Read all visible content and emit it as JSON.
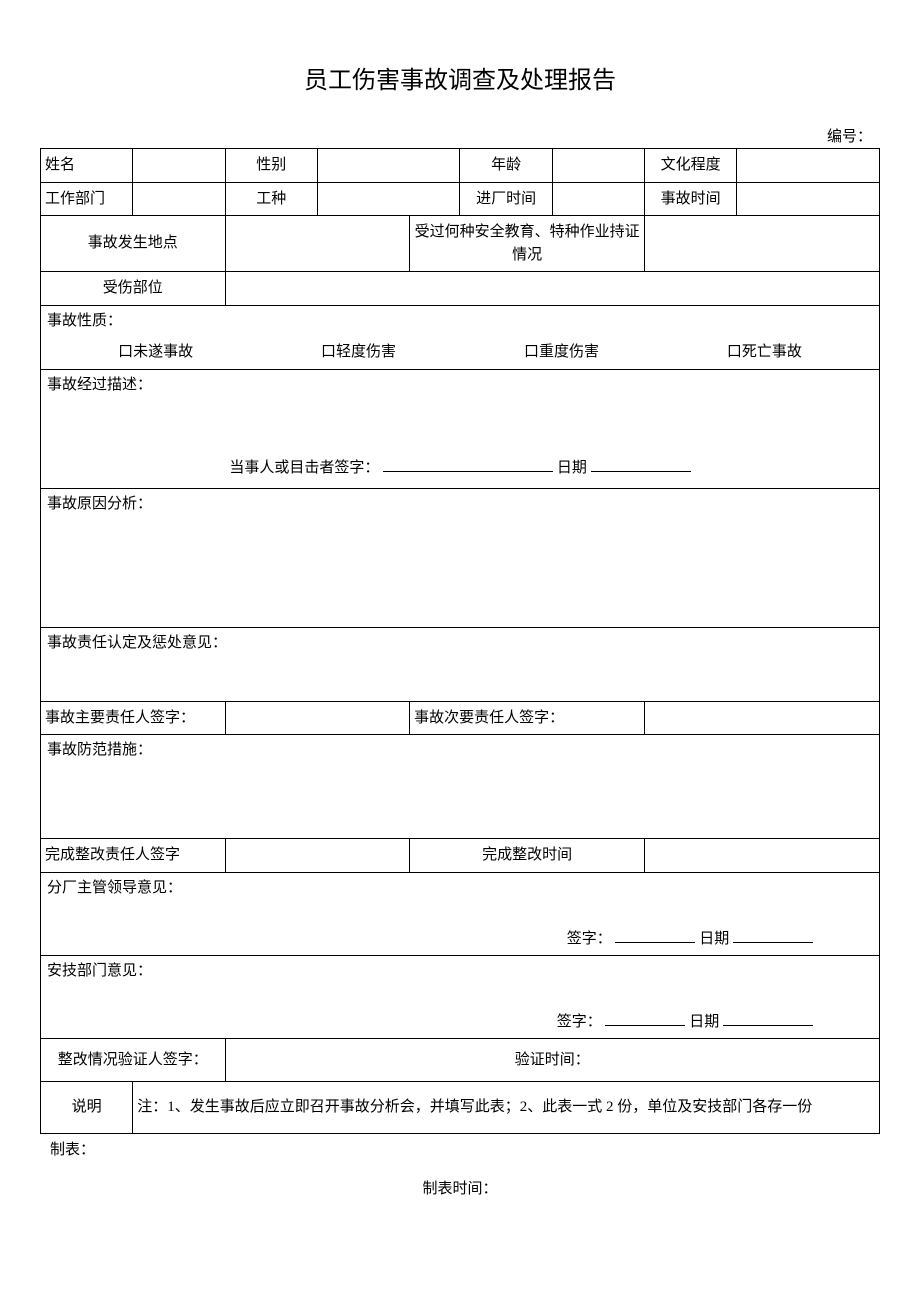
{
  "title": "员工伤害事故调查及处理报告",
  "serial_label": "编号：",
  "row1": {
    "name_label": "姓名",
    "gender_label": "性别",
    "age_label": "年龄",
    "edu_label": "文化程度"
  },
  "row2": {
    "dept_label": "工作部门",
    "worktype_label": "工种",
    "entrytime_label": "进厂时间",
    "acctime_label": "事故时间"
  },
  "row3": {
    "loc_label": "事故发生地点",
    "training_label": "受过何种安全教育、特种作业持证情况"
  },
  "row4": {
    "injury_label": "受伤部位"
  },
  "nature": {
    "label": "事故性质：",
    "opt1": "口未遂事故",
    "opt2": "口轻度伤害",
    "opt3": "口重度伤害",
    "opt4": "口死亡事故"
  },
  "desc": {
    "label": "事故经过描述：",
    "sign_prefix": "当事人或目击者签字：",
    "date_label": "日期"
  },
  "cause_label": "事故原因分析：",
  "responsibility_label": "事故责任认定及惩处意见：",
  "sign_row": {
    "main_label": "事故主要责任人签字：",
    "sec_label": "事故次要责任人签字："
  },
  "prevent_label": "事故防范措施：",
  "rectify_row": {
    "person_label": "完成整改责任人签字",
    "time_label": "完成整改时间"
  },
  "branch": {
    "label": "分厂主管领导意见：",
    "sign": "签字：",
    "date": "日期"
  },
  "safety": {
    "label": "安技部门意见：",
    "sign": "签字：",
    "date": "日期"
  },
  "verify": {
    "person_label": "整改情况验证人签字：",
    "time_label": "验证时间："
  },
  "notes": {
    "label": "说明",
    "text": "注：1、发生事故后应立即召开事故分析会，并填写此表；2、此表一式 2 份，单位及安技部门各存一份"
  },
  "footer": {
    "maker": "制表：",
    "maketime": "制表时间："
  }
}
